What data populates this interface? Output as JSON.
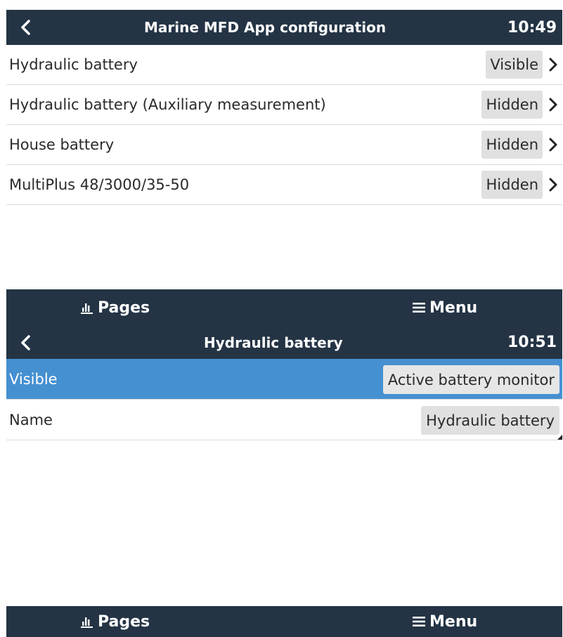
{
  "screens": [
    {
      "title": "Marine MFD App configuration",
      "clock": "10:49",
      "rows": [
        {
          "label": "Hydraulic battery",
          "value": "Visible"
        },
        {
          "label": "Hydraulic battery (Auxiliary measurement)",
          "value": "Hidden"
        },
        {
          "label": "House battery",
          "value": "Hidden"
        },
        {
          "label": "MultiPlus 48/3000/35-50",
          "value": "Hidden"
        }
      ],
      "bottom": {
        "pages_label": "Pages",
        "menu_label": "Menu"
      }
    },
    {
      "title": "Hydraulic battery",
      "clock": "10:51",
      "rows": [
        {
          "label": "Visible",
          "value": "Active battery monitor",
          "selected": true
        },
        {
          "label": "Name",
          "value": "Hydraulic battery"
        }
      ],
      "bottom": {
        "pages_label": "Pages",
        "menu_label": "Menu"
      }
    }
  ],
  "icons": {
    "back": "chevron-left-icon",
    "row_arrow": "chevron-right-icon",
    "pages": "bar-chart-icon",
    "menu": "hamburger-menu-icon"
  },
  "colors": {
    "bar_background": "#243445",
    "selected_row": "#4590d1",
    "value_chip": "#e0e0e0"
  }
}
